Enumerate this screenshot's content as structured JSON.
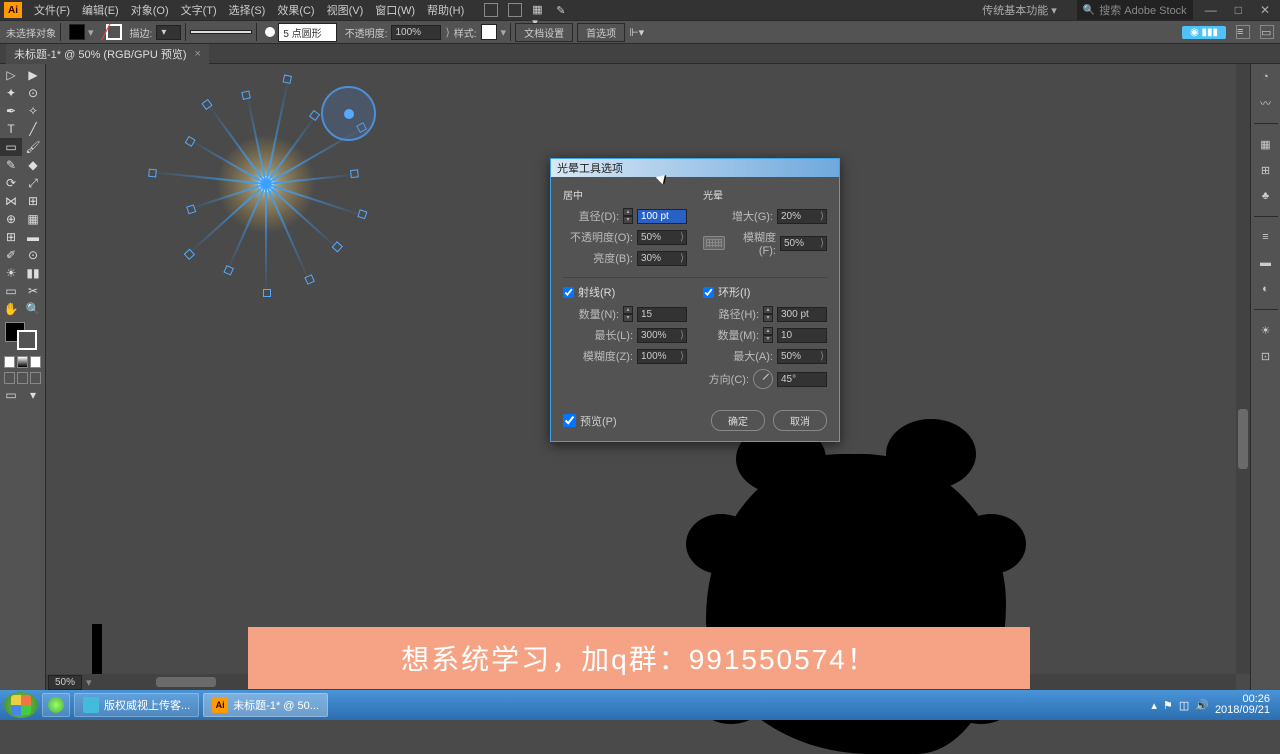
{
  "menubar": {
    "items": [
      "文件(F)",
      "编辑(E)",
      "对象(O)",
      "文字(T)",
      "选择(S)",
      "效果(C)",
      "视图(V)",
      "窗口(W)",
      "帮助(H)"
    ],
    "workspace": "传统基本功能",
    "search_placeholder": "搜索 Adobe Stock"
  },
  "optionsbar": {
    "no_selection": "未选择对象",
    "stroke_label": "描边:",
    "shape_label": "5 点圆形",
    "opacity_label": "不透明度:",
    "opacity_value": "100%",
    "style_label": "样式:",
    "doc_setup": "文档设置",
    "prefs": "首选项"
  },
  "doc_tab": {
    "title": "未标题-1* @ 50% (RGB/GPU 预览)"
  },
  "zoom": "50%",
  "dialog": {
    "title": "光晕工具选项",
    "center_section": "居中",
    "halo_section": "光晕",
    "diameter_label": "直径(D):",
    "diameter_value": "100 pt",
    "opacity_label": "不透明度(O):",
    "opacity_value": "50%",
    "brightness_label": "亮度(B):",
    "brightness_value": "30%",
    "growth_label": "增大(G):",
    "growth_value": "20%",
    "fuzz_label": "模糊度(F):",
    "fuzz_value": "50%",
    "rays_section": "射线(R)",
    "rays_count_label": "数量(N):",
    "rays_count_value": "15",
    "rays_longest_label": "最长(L):",
    "rays_longest_value": "300%",
    "rays_fuzz_label": "模糊度(Z):",
    "rays_fuzz_value": "100%",
    "rings_section": "环形(I)",
    "rings_path_label": "路径(H):",
    "rings_path_value": "300 pt",
    "rings_count_label": "数量(M):",
    "rings_count_value": "10",
    "rings_largest_label": "最大(A):",
    "rings_largest_value": "50%",
    "rings_dir_label": "方向(C):",
    "rings_dir_value": "45°",
    "preview_label": "预览(P)",
    "ok": "确定",
    "cancel": "取消"
  },
  "banner": "想系统学习，加q群：991550574！",
  "taskbar": {
    "items": [
      "版权威视上传客...",
      "未标题-1* @ 50..."
    ],
    "time": "00:26",
    "date": "2018/09/21"
  }
}
